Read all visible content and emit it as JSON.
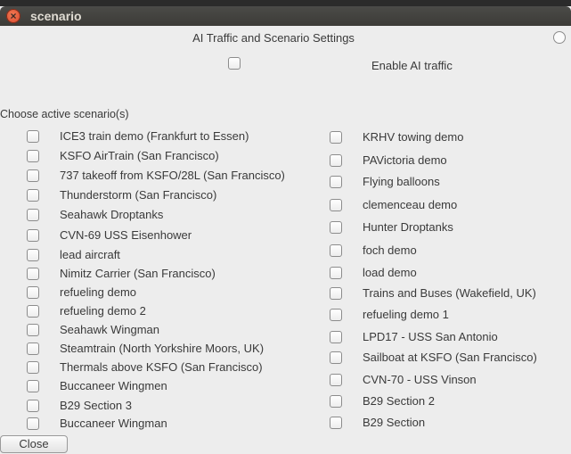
{
  "window": {
    "title": "scenario",
    "close_glyph": "×"
  },
  "dialog": {
    "title": "AI Traffic and Scenario Settings",
    "enable_ai_label": "Enable AI traffic",
    "choose_label": "Choose active scenario(s)",
    "close_label": "Close"
  },
  "scenarios": {
    "left": [
      "ICE3 train demo (Frankfurt to Essen)",
      "KSFO AirTrain (San Francisco)",
      "737 takeoff from KSFO/28L (San Francisco)",
      "Thunderstorm (San Francisco)",
      "Seahawk Droptanks",
      "CVN-69 USS Eisenhower",
      "lead aircraft",
      "Nimitz Carrier (San Francisco)",
      "refueling demo",
      "refueling demo 2",
      "Seahawk Wingman",
      "Steamtrain (North Yorkshire Moors, UK)",
      "Thermals above KSFO (San Francisco)",
      "Buccaneer Wingmen",
      "B29 Section 3",
      "Buccaneer Wingman"
    ],
    "right": [
      "KRHV towing demo",
      "PAVictoria demo",
      "Flying balloons",
      "clemenceau demo",
      "Hunter Droptanks",
      "foch demo",
      "load demo",
      "Trains and Buses (Wakefield, UK)",
      "refueling demo 1",
      "LPD17 - USS San Antonio",
      "Sailboat at KSFO (San Francisco)",
      "CVN-70 - USS Vinson",
      "B29 Section 2",
      "B29 Section"
    ]
  }
}
